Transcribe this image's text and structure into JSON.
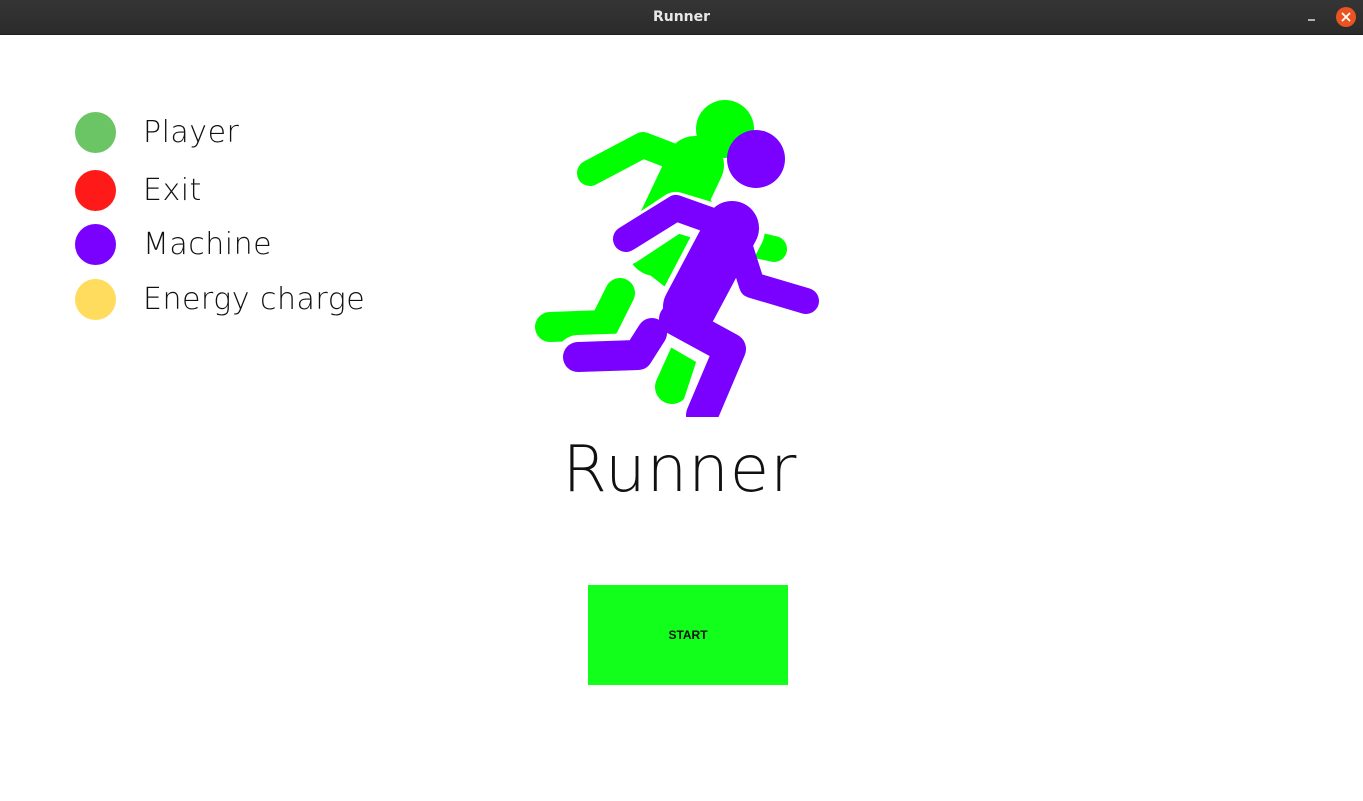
{
  "window": {
    "title": "Runner",
    "controls": [
      "minimize-icon",
      "close-icon"
    ],
    "close_color": "#e95420"
  },
  "legend": {
    "items": [
      {
        "label": "Player",
        "color": "#6cc565"
      },
      {
        "label": "Exit",
        "color": "#ff1a1a"
      },
      {
        "label": "Machine",
        "color": "#7a00ff"
      },
      {
        "label": "Energy charge",
        "color": "#ffdc5e"
      }
    ]
  },
  "logo": {
    "icon": "running-figures-icon",
    "colors": {
      "back_runner": "#00ff00",
      "front_runner": "#7a00ff"
    }
  },
  "main": {
    "title": "Runner",
    "start_label": "START",
    "start_color": "#11ff1a"
  }
}
